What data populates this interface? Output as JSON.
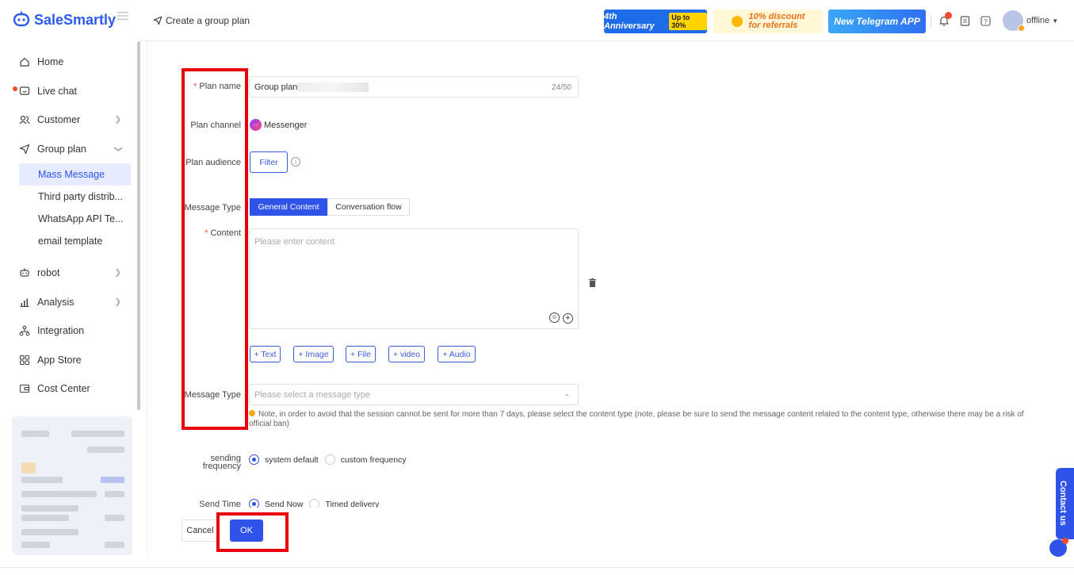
{
  "brand": {
    "name": "SaleSmartly"
  },
  "header": {
    "breadcrumb": "Create a group plan",
    "banners": {
      "anniversary": "4th Anniversary",
      "anniversary_tag": "Up to 30%",
      "referral_line1": "10% discount",
      "referral_line2": "for referrals",
      "telegram": "New Telegram APP"
    },
    "status": "offline"
  },
  "sidebar": {
    "items": [
      {
        "label": "Home"
      },
      {
        "label": "Live chat"
      },
      {
        "label": "Customer"
      },
      {
        "label": "Group plan"
      },
      {
        "label": "robot"
      },
      {
        "label": "Analysis"
      },
      {
        "label": "Integration"
      },
      {
        "label": "App Store"
      },
      {
        "label": "Cost Center"
      }
    ],
    "sub_items": [
      {
        "label": "Mass Message"
      },
      {
        "label": "Third party distrib..."
      },
      {
        "label": "WhatsApp API Te..."
      },
      {
        "label": "email template"
      }
    ]
  },
  "form": {
    "plan_name_label": "Plan name",
    "plan_name_value": "Group plan-",
    "plan_name_counter": "24/50",
    "plan_channel_label": "Plan channel",
    "plan_channel_value": "Messenger",
    "plan_audience_label": "Plan audience",
    "filter_button": "Filter",
    "message_type_label": "Message Type",
    "seg_general": "General Content",
    "seg_flow": "Conversation flow",
    "content_label": "Content",
    "content_placeholder": "Please enter content",
    "add_text": "+ Text",
    "add_image": "+ Image",
    "add_file": "+ File",
    "add_video": "+ video",
    "add_audio": "+ Audio",
    "message_type2_label": "Message Type",
    "message_type2_placeholder": "Please select a message type",
    "note": "Note, in order to avoid that the session cannot be sent for more than 7 days, please select the content type (note, please be sure to send the message content related to the content type, otherwise there may be a risk of official ban)",
    "sending_label_1": "sending",
    "sending_label_2": "frequency",
    "freq_default": "system default",
    "freq_custom": "custom frequency",
    "send_time_label": "Send Time",
    "send_now": "Send Now",
    "timed_delivery": "Timed delivery",
    "cancel_button": "Cancel",
    "ok_button": "OK"
  },
  "contact_us": "Contact us",
  "colors": {
    "primary": "#2f53e8",
    "highlight": "#e8000b"
  }
}
